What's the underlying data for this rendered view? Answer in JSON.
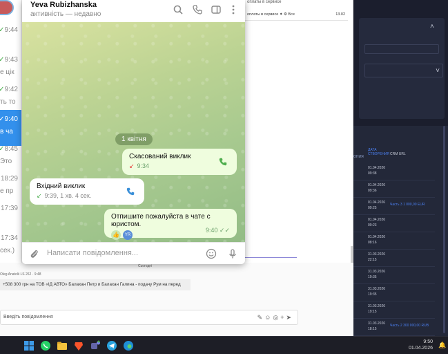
{
  "telegram": {
    "contact_name": "Yeva Rubizhanska",
    "status": "активність — недавно",
    "date_separator": "1 квітня",
    "messages": [
      {
        "title": "Скасований виклик",
        "time": "9:34"
      },
      {
        "title": "Вхідний виклик",
        "meta": "9:39, 1 хв. 4 сек."
      },
      {
        "text": "Отпишите пожалуйста в чате с юристом.",
        "time": "9:40",
        "reaction_avatar": "YR"
      }
    ],
    "composer_placeholder": "Написати повідомлення..."
  },
  "chat_list": {
    "items": [
      {
        "time": "9:44",
        "snippet": "",
        "selected": false,
        "check": "✓"
      },
      {
        "time": "9:43",
        "snippet": "е цік",
        "selected": false,
        "check": "✓"
      },
      {
        "time": "9:42",
        "snippet": "ть то",
        "selected": false,
        "check": "✓"
      },
      {
        "time": "9:40",
        "snippet": "в ча",
        "selected": true,
        "check": "✓"
      },
      {
        "time": "8:45",
        "snippet": "Это",
        "selected": false,
        "check": "✓"
      },
      {
        "time": "18:29",
        "snippet": "е пр",
        "selected": false,
        "check": ""
      },
      {
        "time": "17:39",
        "snippet": "",
        "selected": false,
        "check": ""
      },
      {
        "time": "17:34",
        "snippet": "сек.)",
        "selected": false,
        "check": ""
      }
    ]
  },
  "background_page": {
    "top_text": "оплаты в сервисе",
    "mail_row": {
      "text": "оплаты в сервисе  ⁕  ⚙  Все",
      "date": "13.02"
    },
    "day_label": "Сьогодні",
    "author": "Oleg Anatolii LS 262 · 9:48",
    "message": "+508 300 грн на ТОВ «ІД АВТО» Балахан Петр и Балахан Галина - подачу Рум на перед",
    "input_placeholder": "Введіть повідомлення",
    "input_tools": "✎☺◎+➤"
  },
  "crm": {
    "columns": [
      "ОНИЯ",
      "ДАТА СТВОРЕНИЯ",
      "CRM URL"
    ],
    "rows": [
      {
        "date": "01.04.2026",
        "time": "09:38",
        "amount": ""
      },
      {
        "date": "01.04.2026",
        "time": "09:36",
        "amount": ""
      },
      {
        "date": "01.04.2026",
        "time": "09:25",
        "amount": "Часть 3 1 000,00 EUR"
      },
      {
        "date": "01.04.2026",
        "time": "09:23",
        "amount": ""
      },
      {
        "date": "01.04.2026",
        "time": "08:16",
        "amount": ""
      },
      {
        "date": "31.03.2026",
        "time": "22:15",
        "amount": ""
      },
      {
        "date": "31.03.2026",
        "time": "19:35",
        "amount": ""
      },
      {
        "date": "31.03.2026",
        "time": "19:35",
        "amount": ""
      },
      {
        "date": "31.03.2026",
        "time": "19:15",
        "amount": ""
      },
      {
        "date": "31.03.2026",
        "time": "18:15",
        "amount": "Часть 2 300 000,00 RUB"
      }
    ]
  },
  "taskbar": {
    "time": "9:50",
    "date": "01.04.2026"
  }
}
